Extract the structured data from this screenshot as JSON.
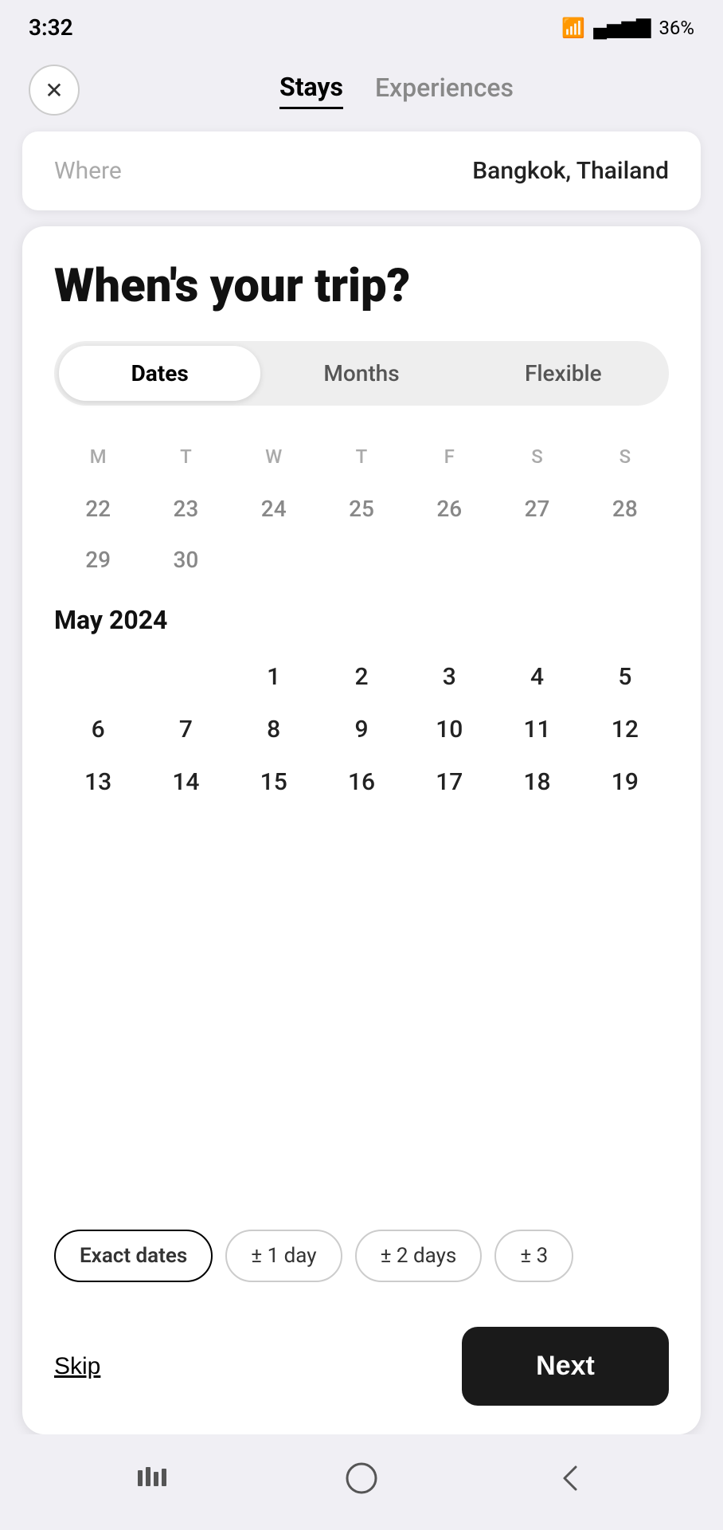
{
  "statusBar": {
    "time": "3:32",
    "battery": "36%"
  },
  "nav": {
    "closeLabel": "×",
    "tabs": [
      {
        "label": "Stays",
        "active": true
      },
      {
        "label": "Experiences",
        "active": false
      }
    ]
  },
  "whereCard": {
    "label": "Where",
    "value": "Bangkok, Thailand"
  },
  "mainCard": {
    "title": "When's your trip?",
    "toggleTabs": [
      {
        "label": "Dates",
        "active": true
      },
      {
        "label": "Months",
        "active": false
      },
      {
        "label": "Flexible",
        "active": false
      }
    ],
    "calendarHeaders": [
      "M",
      "T",
      "W",
      "T",
      "F",
      "S",
      "S"
    ],
    "prevMonthDates": [
      {
        "day": "22",
        "type": "prev"
      },
      {
        "day": "23",
        "type": "prev"
      },
      {
        "day": "24",
        "type": "prev"
      },
      {
        "day": "25",
        "type": "prev"
      },
      {
        "day": "26",
        "type": "prev"
      },
      {
        "day": "27",
        "type": "prev"
      },
      {
        "day": "28",
        "type": "prev"
      },
      {
        "day": "29",
        "type": "prev"
      },
      {
        "day": "30",
        "type": "prev"
      }
    ],
    "currentMonth": "May 2024",
    "may2024Grid": [
      {
        "day": "",
        "empty": true
      },
      {
        "day": "",
        "empty": true
      },
      {
        "day": "1"
      },
      {
        "day": "2"
      },
      {
        "day": "3"
      },
      {
        "day": "4"
      },
      {
        "day": "5"
      },
      {
        "day": "6"
      },
      {
        "day": "7"
      },
      {
        "day": "8"
      },
      {
        "day": "9"
      },
      {
        "day": "10"
      },
      {
        "day": "11"
      },
      {
        "day": "12"
      },
      {
        "day": "13"
      },
      {
        "day": "14"
      },
      {
        "day": "15"
      },
      {
        "day": "16"
      },
      {
        "day": "17"
      },
      {
        "day": "18"
      },
      {
        "day": "19"
      }
    ],
    "flexPills": [
      {
        "label": "Exact dates",
        "active": true
      },
      {
        "label": "± 1 day",
        "active": false
      },
      {
        "label": "± 2 days",
        "active": false
      },
      {
        "label": "± 3",
        "active": false
      }
    ],
    "skipLabel": "Skip",
    "nextLabel": "Next"
  },
  "systemNav": {
    "backLabel": "<",
    "homeLabel": "○",
    "recentLabel": "|||"
  }
}
